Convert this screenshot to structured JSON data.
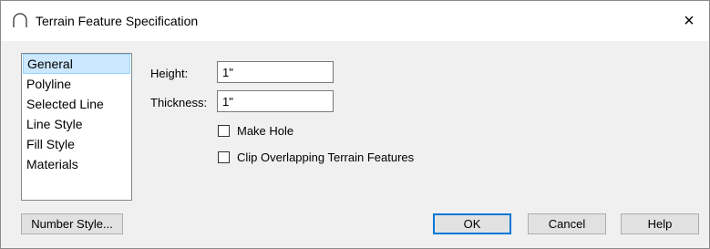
{
  "window": {
    "title": "Terrain Feature Specification",
    "close_glyph": "×",
    "icon": "arc-icon"
  },
  "categories": [
    {
      "label": "General",
      "selected": true
    },
    {
      "label": "Polyline",
      "selected": false
    },
    {
      "label": "Selected Line",
      "selected": false
    },
    {
      "label": "Line Style",
      "selected": false
    },
    {
      "label": "Fill Style",
      "selected": false
    },
    {
      "label": "Materials",
      "selected": false
    }
  ],
  "fields": {
    "height": {
      "label": "Height:",
      "value": "1\""
    },
    "thickness": {
      "label": "Thickness:",
      "value": "1\""
    }
  },
  "checkboxes": {
    "make_hole": {
      "label": "Make Hole",
      "checked": false
    },
    "clip_overlapping": {
      "label": "Clip Overlapping Terrain Features",
      "checked": false
    }
  },
  "buttons": {
    "number_style": "Number Style...",
    "ok": "OK",
    "cancel": "Cancel",
    "help": "Help"
  },
  "colors": {
    "selection_bg": "#cce8ff",
    "default_button_border": "#0078d7"
  }
}
